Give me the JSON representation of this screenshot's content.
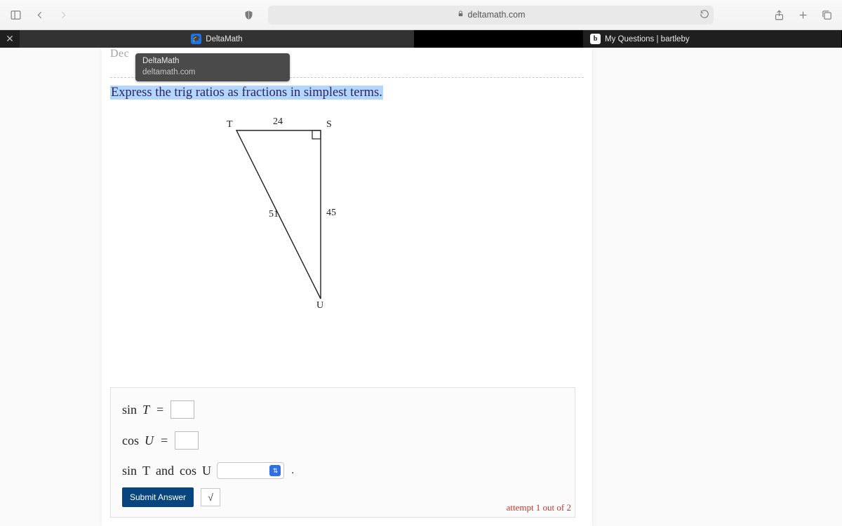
{
  "browser": {
    "address": "deltamath.com"
  },
  "tabs": {
    "left": "DeltaMath",
    "right": "My Questions | bartleby"
  },
  "tooltip": {
    "title": "DeltaMath",
    "subtitle": "deltamath.com"
  },
  "partial": "Dec",
  "prompt": "Express the trig ratios as fractions in simplest terms.",
  "triangle": {
    "T": "T",
    "S": "S",
    "U": "U",
    "top": "24",
    "right": "45",
    "hyp": "51"
  },
  "answers": {
    "row1": {
      "fn": "sin",
      "ang": "T",
      "eq": "="
    },
    "row2": {
      "fn": "cos",
      "ang": "U",
      "eq": "="
    },
    "relation": {
      "fn1": "sin",
      "a1": "T",
      "and": "and",
      "fn2": "cos",
      "a2": "U",
      "period": "."
    }
  },
  "buttons": {
    "submit": "Submit Answer",
    "sqrt": "√"
  },
  "attempt": "attempt 1 out of 2"
}
